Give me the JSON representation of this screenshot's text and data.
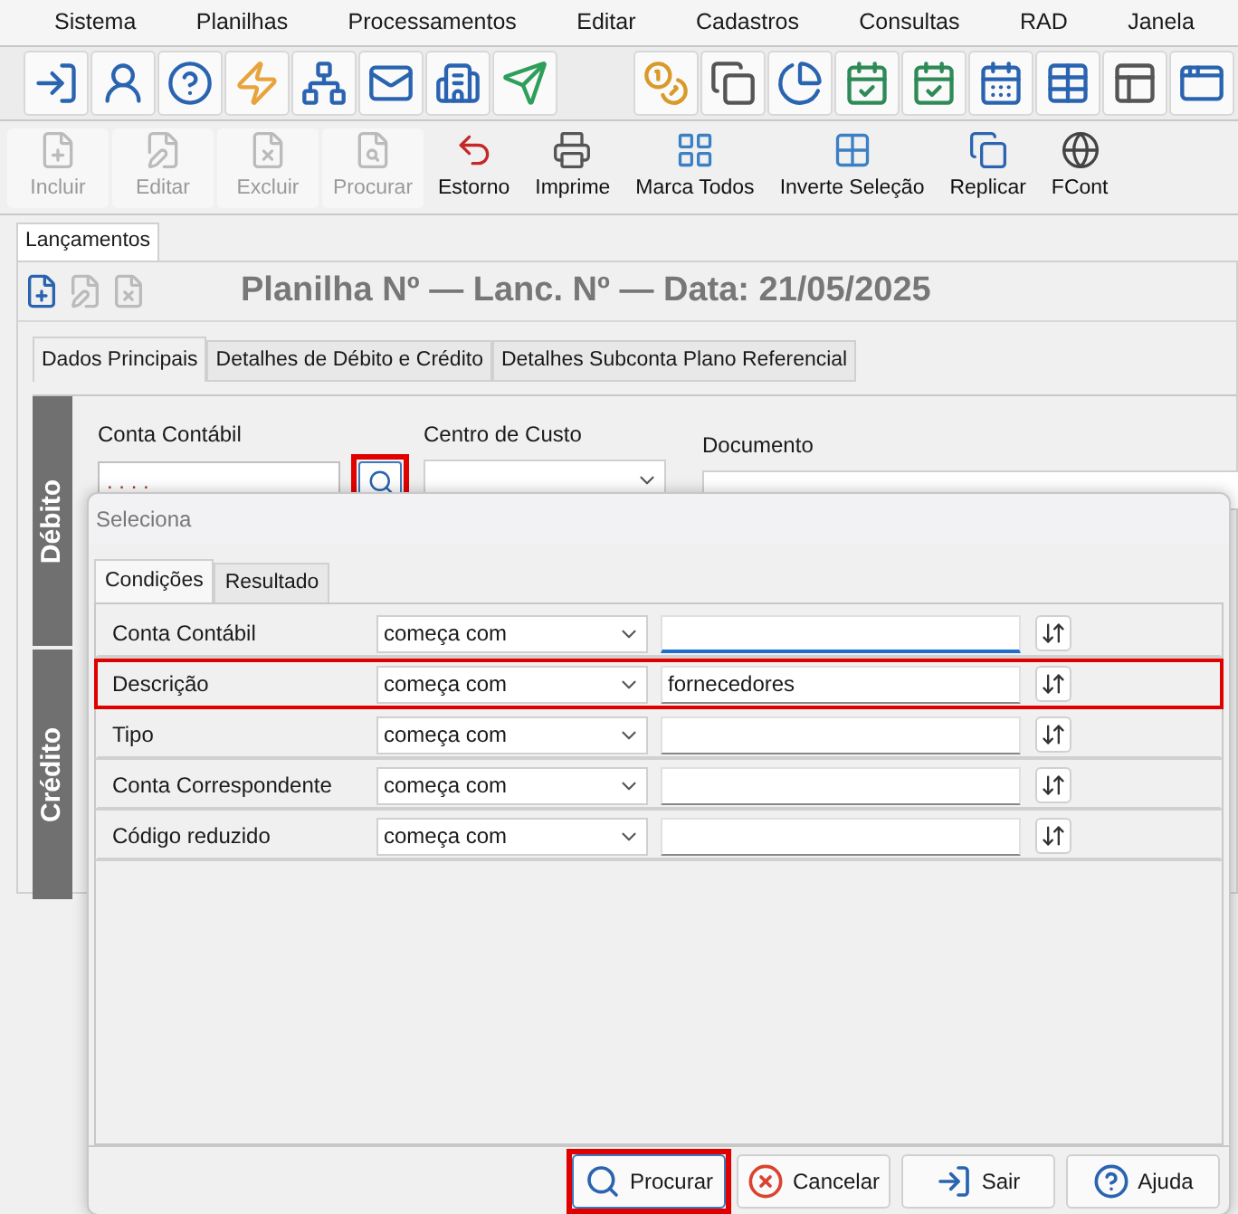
{
  "menu": [
    "Sistema",
    "Planilhas",
    "Processamentos",
    "Editar",
    "Cadastros",
    "Consultas",
    "RAD",
    "Janela"
  ],
  "actions": [
    {
      "label": "Incluir",
      "disabled": true
    },
    {
      "label": "Editar",
      "disabled": true
    },
    {
      "label": "Excluir",
      "disabled": true
    },
    {
      "label": "Procurar",
      "disabled": true
    },
    {
      "label": "Estorno",
      "disabled": false
    },
    {
      "label": "Imprime",
      "disabled": false
    },
    {
      "label": "Marca Todos",
      "disabled": false
    },
    {
      "label": "Inverte Seleção",
      "disabled": false
    },
    {
      "label": "Replicar",
      "disabled": false
    },
    {
      "label": "FCont",
      "disabled": false
    }
  ],
  "document_tabs": [
    {
      "label": "Lançamentos",
      "selected": true
    }
  ],
  "header": {
    "title": "Planilha Nº — Lanc. Nº — Data: 21/05/2025"
  },
  "tabs": [
    {
      "label": "Dados Principais",
      "selected": true
    },
    {
      "label": "Detalhes de Débito e Crédito",
      "selected": false
    },
    {
      "label": "Detalhes Subconta Plano Referencial",
      "selected": false
    }
  ],
  "debit": {
    "side_label": "Débito",
    "account_label": "Conta Contábil",
    "account_value": ". . . .",
    "search_highlighted": true,
    "cost_center_label": "Centro de Custo",
    "document_label": "Documento"
  },
  "credit": {
    "side_label": "Crédito"
  },
  "dialog": {
    "title": "Seleciona",
    "tabs": [
      {
        "label": "Condições",
        "selected": true
      },
      {
        "label": "Resultado",
        "selected": false
      }
    ],
    "conditions": [
      {
        "field": "Conta Contábil",
        "operator": "começa com",
        "focused": true,
        "highlighted": false
      },
      {
        "field": "Descrição",
        "operator": "começa com",
        "value": "fornecedores",
        "focused": false,
        "highlighted": true
      },
      {
        "field": "Tipo",
        "operator": "começa com",
        "focused": false,
        "highlighted": false
      },
      {
        "field": "Conta Correspondente",
        "operator": "começa com",
        "focused": false,
        "highlighted": false
      },
      {
        "field": "Código reduzido",
        "operator": "começa com",
        "focused": false,
        "highlighted": false
      }
    ],
    "buttons": [
      {
        "kind": "search",
        "label": "Procurar",
        "highlighted": true
      },
      {
        "kind": "cancel",
        "label": "Cancelar",
        "highlighted": false
      },
      {
        "kind": "exit",
        "label": "Sair",
        "highlighted": false
      },
      {
        "kind": "help",
        "label": "Ajuda",
        "highlighted": false
      }
    ]
  }
}
